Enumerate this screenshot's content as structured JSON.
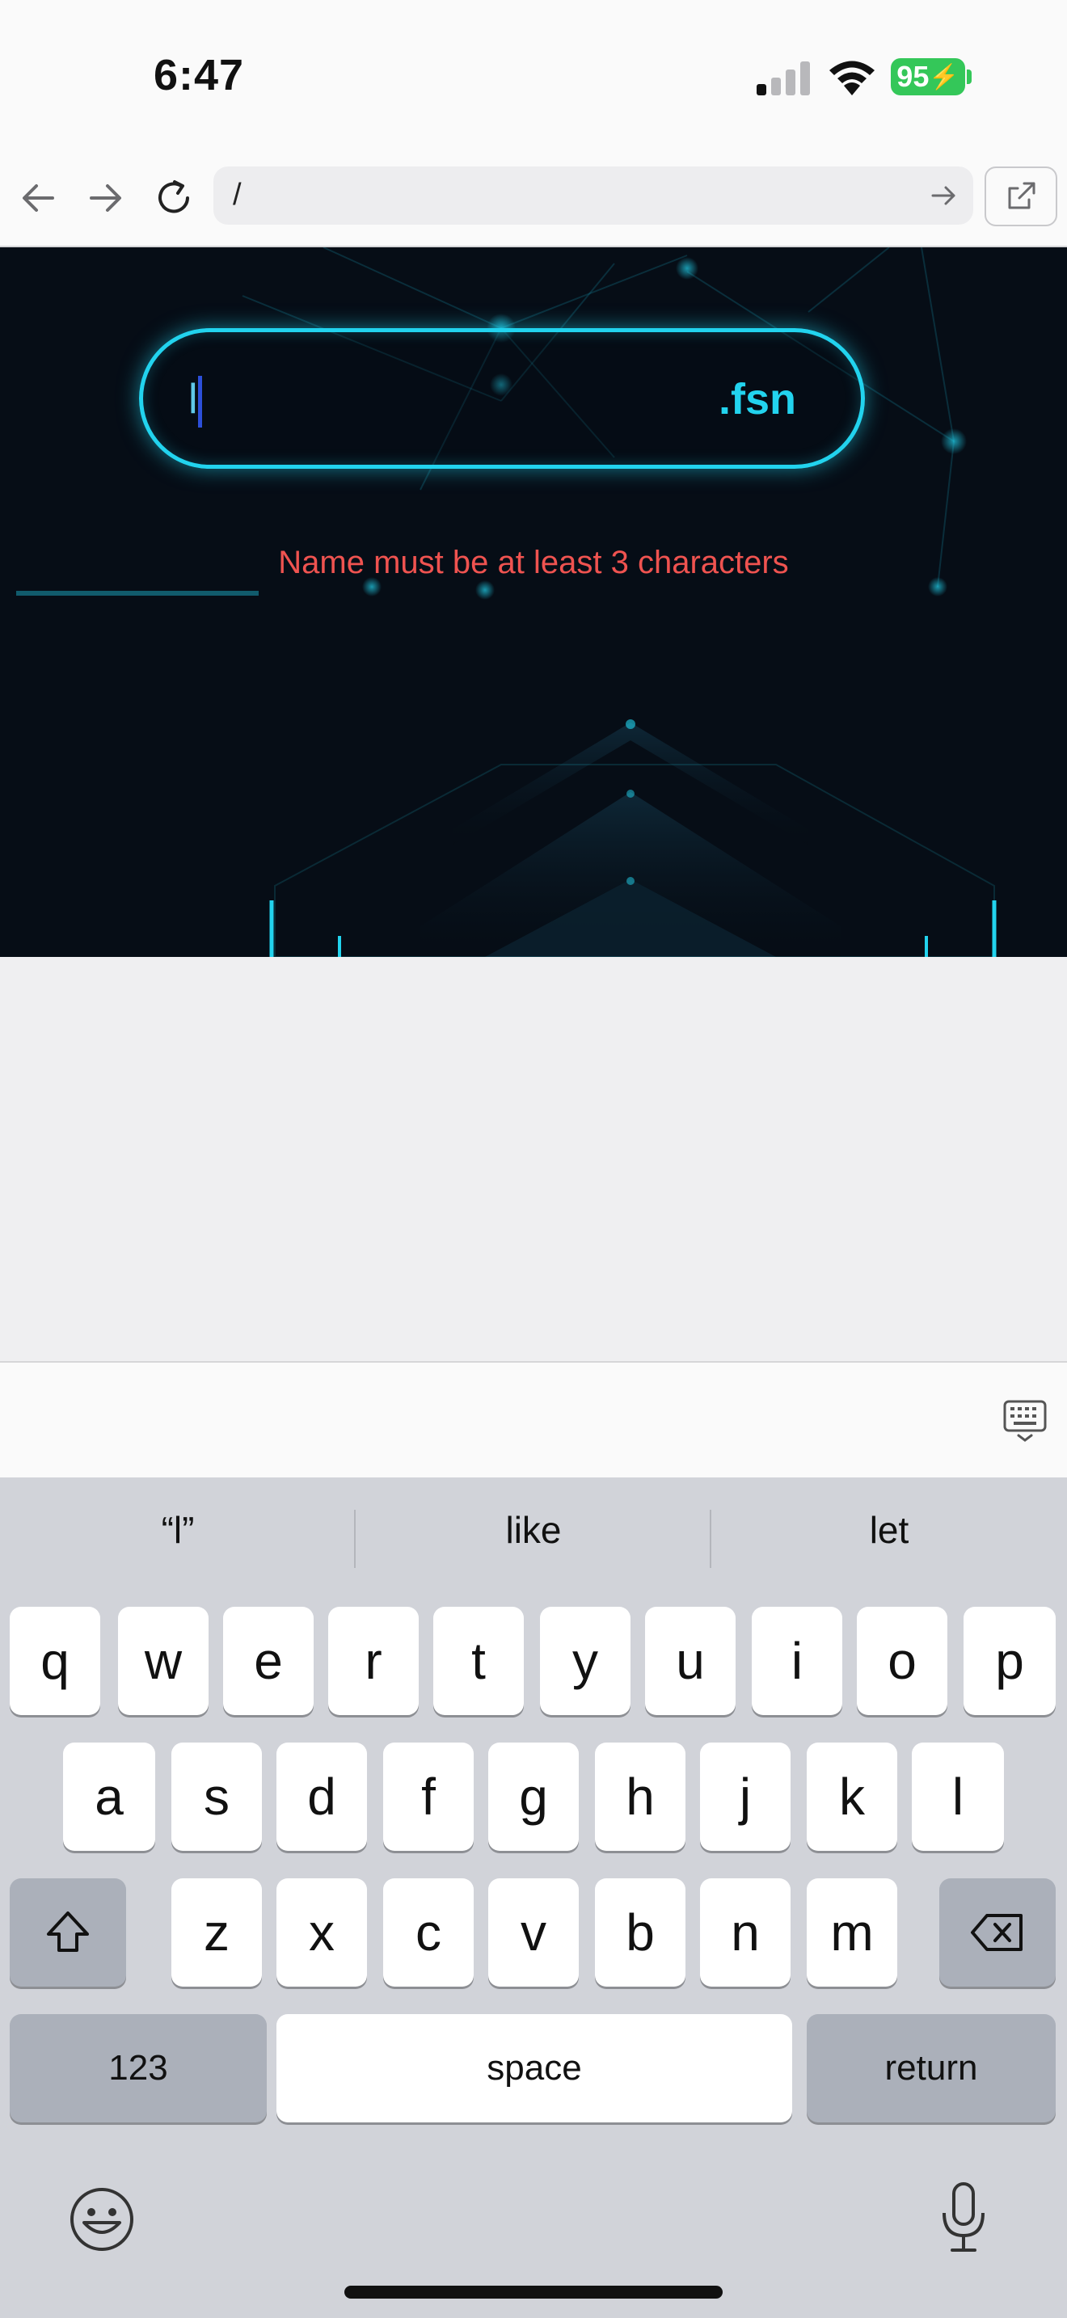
{
  "status_bar": {
    "time": "6:47",
    "battery": "95"
  },
  "browser": {
    "url": "/"
  },
  "page": {
    "input_value": "l",
    "suffix": ".fsn",
    "error": "Name must be at least 3 characters"
  },
  "keyboard": {
    "suggestions": [
      "“l”",
      "like",
      "let"
    ],
    "row1": [
      "q",
      "w",
      "e",
      "r",
      "t",
      "y",
      "u",
      "i",
      "o",
      "p"
    ],
    "row2": [
      "a",
      "s",
      "d",
      "f",
      "g",
      "h",
      "j",
      "k",
      "l"
    ],
    "row3": [
      "z",
      "x",
      "c",
      "v",
      "b",
      "n",
      "m"
    ],
    "numbers_label": "123",
    "space_label": "space",
    "return_label": "return"
  },
  "colors": {
    "accent": "#22d3ee",
    "error": "#ef5350",
    "battery": "#34c759"
  }
}
